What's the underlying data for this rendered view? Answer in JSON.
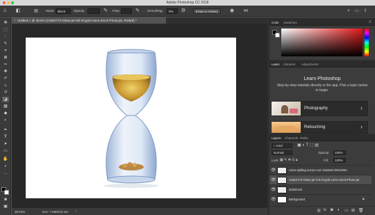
{
  "window": {
    "title": "Adobe Photoshop CC 2018",
    "colors": {
      "close": "#ff5f57",
      "minimize": "#febc2e",
      "zoom": "#28c840"
    }
  },
  "options_bar": {
    "mode_label": "Mode:",
    "mode_value": "Block",
    "opacity_label": "Opacity:",
    "flow_label": "Flow:",
    "smoothing_label": "Smoothing:",
    "smoothing_value": "0%",
    "erase_to_history": "Erase to History"
  },
  "document": {
    "tab_label": "Untitled-1 @ 38.6% (21863773-Glass-jar-full-of-gold-coins-Stock-Photo-jar, RGB/8) *",
    "zoom": "38.63%",
    "doc_size": "Doc: 7.66M/10.1M"
  },
  "color_panel": {
    "tabs": [
      "Color",
      "Swatches"
    ],
    "active_tab": 0
  },
  "learn_panel": {
    "tabs": [
      "Learn",
      "Libraries",
      "Adjustments"
    ],
    "active_tab": 0,
    "heading": "Learn Photoshop",
    "description": "Step-by-step tutorials directly in the app. Pick a topic below to begin.",
    "topics": [
      "Photography",
      "Retouching"
    ]
  },
  "layers_panel": {
    "tabs": [
      "Layers",
      "Channels",
      "Paths"
    ],
    "active_tab": 0,
    "kind_label": "Kind",
    "blend_mode": "Normal",
    "opacity_label": "Opacity:",
    "opacity_value": "100%",
    "lock_label": "Lock:",
    "fill_label": "Fill:",
    "fill_value": "100%",
    "layers": [
      {
        "name": "coins-spilling-out-jar-coci-isolated-29011064",
        "selected": false
      },
      {
        "name": "21863773-Glass-jar-full-of-gold-coins-Stock-Photo-jar",
        "selected": true
      },
      {
        "name": "50330134",
        "selected": false
      },
      {
        "name": "Background",
        "selected": false
      }
    ]
  },
  "accent": "#3d7bd6"
}
